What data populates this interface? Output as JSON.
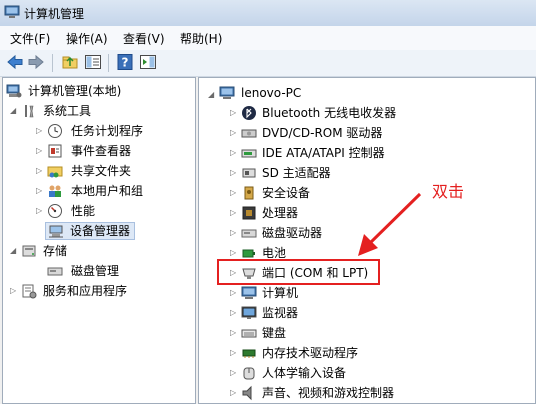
{
  "window": {
    "title": "计算机管理"
  },
  "menu": [
    {
      "label": "文件(F)"
    },
    {
      "label": "操作(A)"
    },
    {
      "label": "查看(V)"
    },
    {
      "label": "帮助(H)"
    }
  ],
  "left_tree": {
    "root": "计算机管理(本地)",
    "system_tools": "系统工具",
    "items": [
      "任务计划程序",
      "事件查看器",
      "共享文件夹",
      "本地用户和组",
      "性能",
      "设备管理器"
    ],
    "storage": "存储",
    "disk_mgmt": "磁盘管理",
    "services": "服务和应用程序"
  },
  "right_tree": {
    "root": "lenovo-PC",
    "devices": [
      "Bluetooth 无线电收发器",
      "DVD/CD-ROM 驱动器",
      "IDE ATA/ATAPI 控制器",
      "SD 主适配器",
      "安全设备",
      "处理器",
      "磁盘驱动器",
      "电池",
      "端口 (COM 和 LPT)",
      "计算机",
      "监视器",
      "键盘",
      "内存技术驱动程序",
      "人体学输入设备",
      "声音、视频和游戏控制器"
    ]
  },
  "annotation": {
    "text": "双击",
    "color": "#e42020"
  }
}
